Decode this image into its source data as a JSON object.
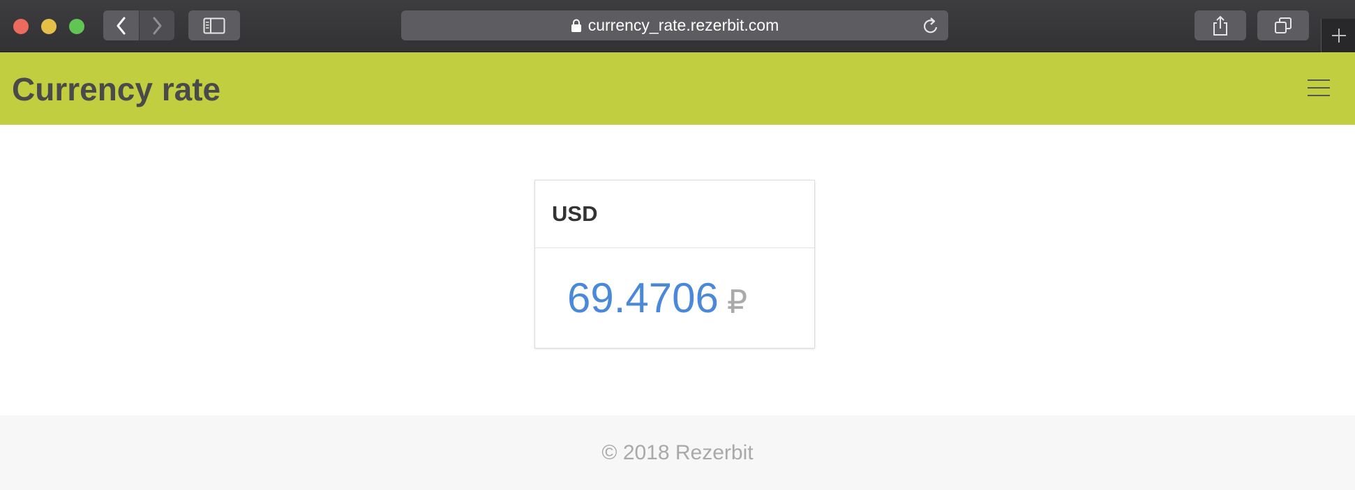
{
  "browser": {
    "url": "currency_rate.rezerbit.com",
    "icons": {
      "back": "chevron-left-icon",
      "forward": "chevron-right-icon",
      "sidebar": "sidebar-icon",
      "lock": "lock-icon",
      "reload": "reload-icon",
      "share": "share-icon",
      "tabs": "tabs-overview-icon",
      "new_tab": "plus-icon"
    }
  },
  "navbar": {
    "brand": "Currency rate",
    "menu_icon": "hamburger-icon",
    "background_color": "#c0ce40"
  },
  "rate_card": {
    "currency_code": "USD",
    "rate": "69.4706",
    "currency_symbol": "₽",
    "rate_color": "#4a88da"
  },
  "footer": {
    "copyright": "© 2018 Rezerbit"
  }
}
